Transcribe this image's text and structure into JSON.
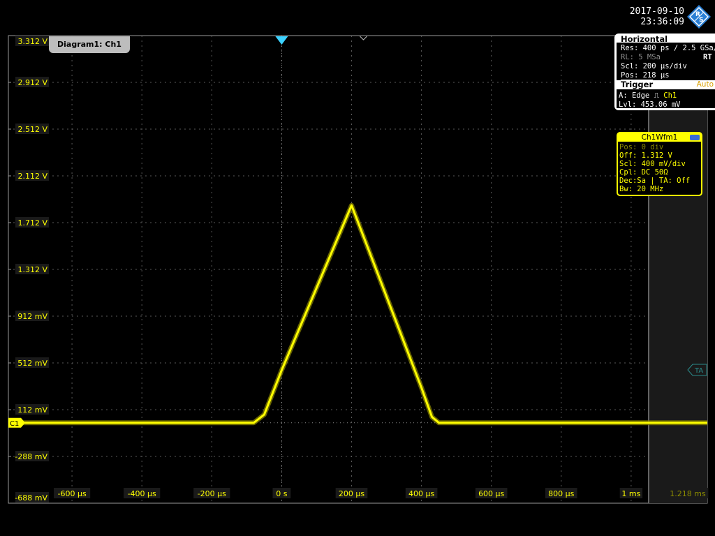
{
  "datetime": {
    "date": "2017-09-10",
    "time": "23:36:09"
  },
  "logo": {
    "text": "R&S"
  },
  "horizontal": {
    "title": "Horizontal",
    "res": "Res: 400 ps / 2.5 GSa/s",
    "rl": "RL:  5 MSa",
    "rt": "RT",
    "scl": "Scl: 200 µs/div",
    "pos": "Pos: 218 µs"
  },
  "trigger": {
    "title": "Trigger",
    "mode": "Auto",
    "source_prefix": "A:  Edge",
    "source": "Ch1",
    "level": "Lvl: 453.06 mV"
  },
  "wfm": {
    "title": "Ch1Wfm1",
    "pos": "Pos: 0 div",
    "off": "Off: 1.312 V",
    "scl": "Scl: 400 mV/div",
    "cpl": "Cpl: DC 50Ω",
    "dec": "Dec:Sa | TA: Off",
    "bw": "Bw: 20 MHz"
  },
  "diagram_tab": "Diagram1: Ch1",
  "colors": {
    "trace": "#ffff00",
    "grid": "#5a5a5a",
    "trigger_marker": "#3cd2ff",
    "panel_border": "#ffffff"
  },
  "markers": {
    "channel": "C1",
    "ta": "TA"
  },
  "chart_data": {
    "type": "line",
    "x_unit": "µs",
    "y_unit": "V",
    "x_tick_labels": [
      "-600 µs",
      "-400 µs",
      "-200 µs",
      "0 s",
      "200 µs",
      "400 µs",
      "600 µs",
      "800 µs",
      "1 ms",
      "1.218 ms"
    ],
    "x_ticks": [
      -600,
      -400,
      -200,
      0,
      200,
      400,
      600,
      800,
      1000,
      1218
    ],
    "y_tick_labels": [
      "3.312 V",
      "2.912 V",
      "2.512 V",
      "2.112 V",
      "1.712 V",
      "1.312 V",
      "912 mV",
      "512 mV",
      "112 mV",
      "-288 mV",
      "-688 mV"
    ],
    "y_ticks": [
      3.312,
      2.912,
      2.512,
      2.112,
      1.712,
      1.312,
      0.912,
      0.512,
      0.112,
      -0.288,
      -0.688
    ],
    "xlim": [
      -782,
      1218
    ],
    "ylim": [
      -0.688,
      3.312
    ],
    "grid": true,
    "series": [
      {
        "name": "Ch1",
        "x": [
          -782,
          -80,
          -50,
          0,
          200,
          400,
          430,
          450,
          1218
        ],
        "y": [
          0.0,
          0.0,
          0.07,
          0.45,
          1.86,
          0.3,
          0.05,
          0.0,
          0.0
        ]
      }
    ],
    "trigger_time": 0,
    "position_time": 218,
    "channel_level": 0.0
  }
}
